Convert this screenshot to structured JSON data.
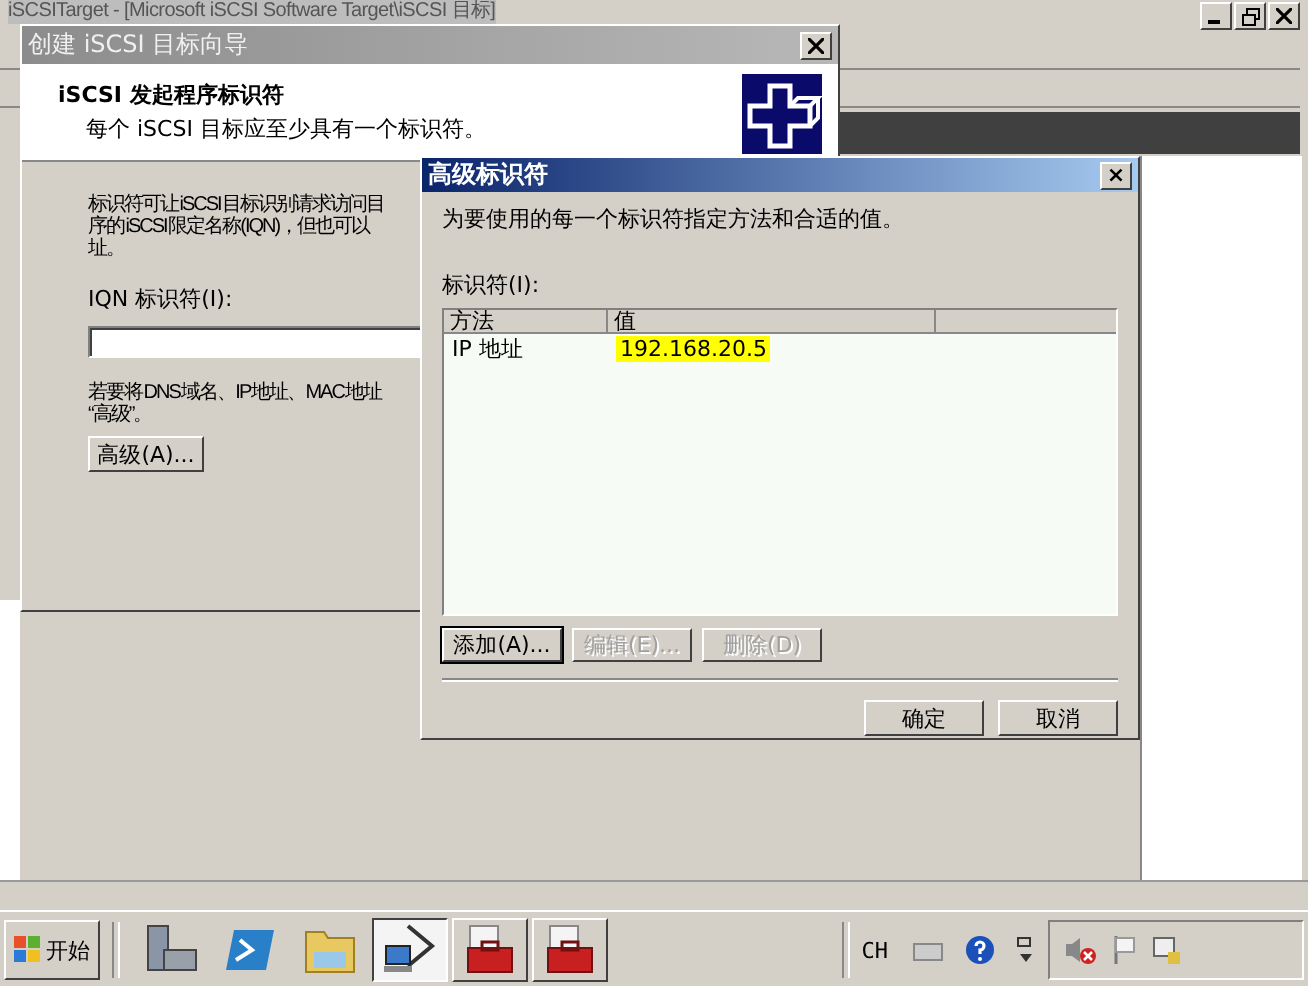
{
  "main_window": {
    "title": "iSCSITarget - [Microsoft iSCSI Software Target\\iSCSI 目标]"
  },
  "wizard": {
    "title": "创建 iSCSI 目标向导",
    "heading": "iSCSI 发起程序标识符",
    "subheading": "每个 iSCSI 目标应至少具有一个标识符。",
    "description_lines": [
      "标识符可让 iSCSI 目标识别请求访问目",
      "序的 iSCSI 限定名称(IQN)，但也可以",
      "址。"
    ],
    "iqn_label": "IQN 标识符(I):",
    "hint_lines": [
      "若要将 DNS 域名、IP 地址、MAC 地址",
      "“高级”。"
    ],
    "advanced_button": "高级(A)..."
  },
  "dialog": {
    "title": "高级标识符",
    "close": "×",
    "description": "为要使用的每一个标识符指定方法和合适的值。",
    "list_label": "标识符(I):",
    "columns": [
      "方法",
      "值"
    ],
    "rows": [
      {
        "method": "IP 地址",
        "value": "192.168.20.5",
        "selected": true
      }
    ],
    "action_buttons": [
      {
        "label": "添加(A)...",
        "disabled": false
      },
      {
        "label": "编辑(E)...",
        "disabled": true
      },
      {
        "label": "删除(D)",
        "disabled": true
      }
    ],
    "ok": "确定",
    "cancel": "取消"
  },
  "taskbar": {
    "start": "开始",
    "language": "CH",
    "items": [
      {
        "kind": "server",
        "pressed": false
      },
      {
        "kind": "shell",
        "pressed": false
      },
      {
        "kind": "folder",
        "pressed": false
      },
      {
        "kind": "network",
        "pressed": true
      },
      {
        "kind": "toolbox",
        "pressed": false
      },
      {
        "kind": "toolbox",
        "pressed": false
      }
    ]
  }
}
